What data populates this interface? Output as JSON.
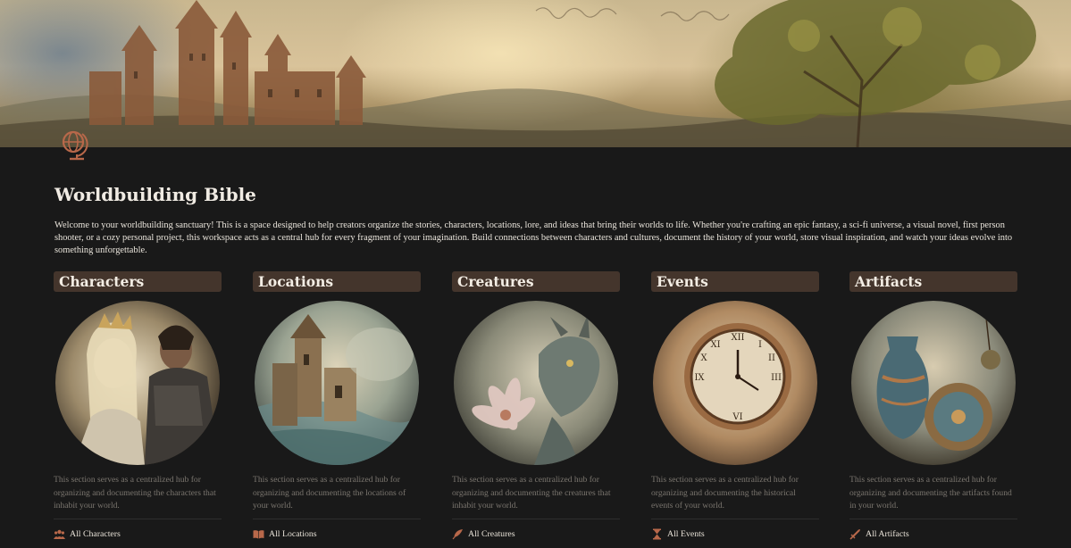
{
  "page": {
    "title": "Worldbuilding Bible",
    "icon": "globe-icon",
    "intro": "Welcome to your worldbuilding sanctuary! This is a space designed to help creators organize the stories, characters, locations, lore, and ideas that bring their worlds to life. Whether you're crafting an epic fantasy, a sci-fi universe, a visual novel, first person shooter, or a cozy personal project, this workspace acts as a central hub for every fragment of your imagination. Build connections between characters and cultures, document the history of your world, store visual inspiration, and watch your ideas evolve into something unforgettable.",
    "accent_color": "#b8684a",
    "header_color": "#44352c"
  },
  "sections": [
    {
      "title": "Characters",
      "image": "characters-medallion",
      "description": "This section serves as a centralized hub for organizing and documenting the characters that inhabit your world.",
      "link_label": "All Characters",
      "link_icon": "people-icon"
    },
    {
      "title": "Locations",
      "image": "locations-medallion",
      "description": "This section serves as a centralized hub for organizing and documenting the locations of your world.",
      "link_label": "All Locations",
      "link_icon": "book-open-icon"
    },
    {
      "title": "Creatures",
      "image": "creatures-medallion",
      "description": "This section serves as a centralized hub for organizing and documenting the creatures that inhabit your world.",
      "link_label": "All Creatures",
      "link_icon": "feather-icon"
    },
    {
      "title": "Events",
      "image": "events-medallion",
      "description": "This section serves as a centralized hub for organizing and documenting the historical events of your world.",
      "link_label": "All Events",
      "link_icon": "hourglass-icon"
    },
    {
      "title": "Artifacts",
      "image": "artifacts-medallion",
      "description": "This section serves as a centralized hub for organizing and documenting the artifacts found in your world.",
      "link_label": "All Artifacts",
      "link_icon": "sword-icon"
    }
  ]
}
